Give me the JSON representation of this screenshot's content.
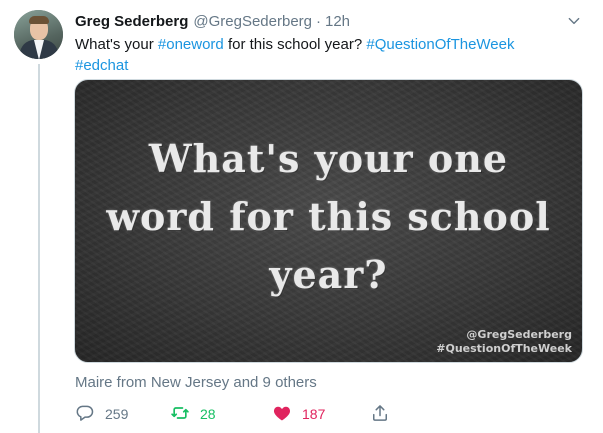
{
  "tweet": {
    "author_name": "Greg Sederberg",
    "handle": "@GregSederberg",
    "separator": "·",
    "time": "12h",
    "text_parts": {
      "t1": "What's your ",
      "tag1": "#oneword",
      "t2": " for this school year? ",
      "tag2": "#QuestionOfTheWeek",
      "tag3": "#edchat"
    },
    "image": {
      "line1": "What's your one",
      "line2": "word for this school",
      "line3": "year?",
      "watermark_1": "@GregSederberg",
      "watermark_2": "#QuestionOfTheWeek"
    },
    "liked_by": "Maire from New Jersey and 9 others",
    "actions": {
      "replies": "259",
      "retweets": "28",
      "likes": "187"
    }
  },
  "colors": {
    "link": "#1b95e0",
    "retweet_active": "#17bf63",
    "like_active": "#e0245e",
    "secondary_text": "#657786"
  },
  "icons": [
    "reply-icon",
    "retweet-icon",
    "heart-icon",
    "share-icon",
    "chevron-down-icon"
  ]
}
